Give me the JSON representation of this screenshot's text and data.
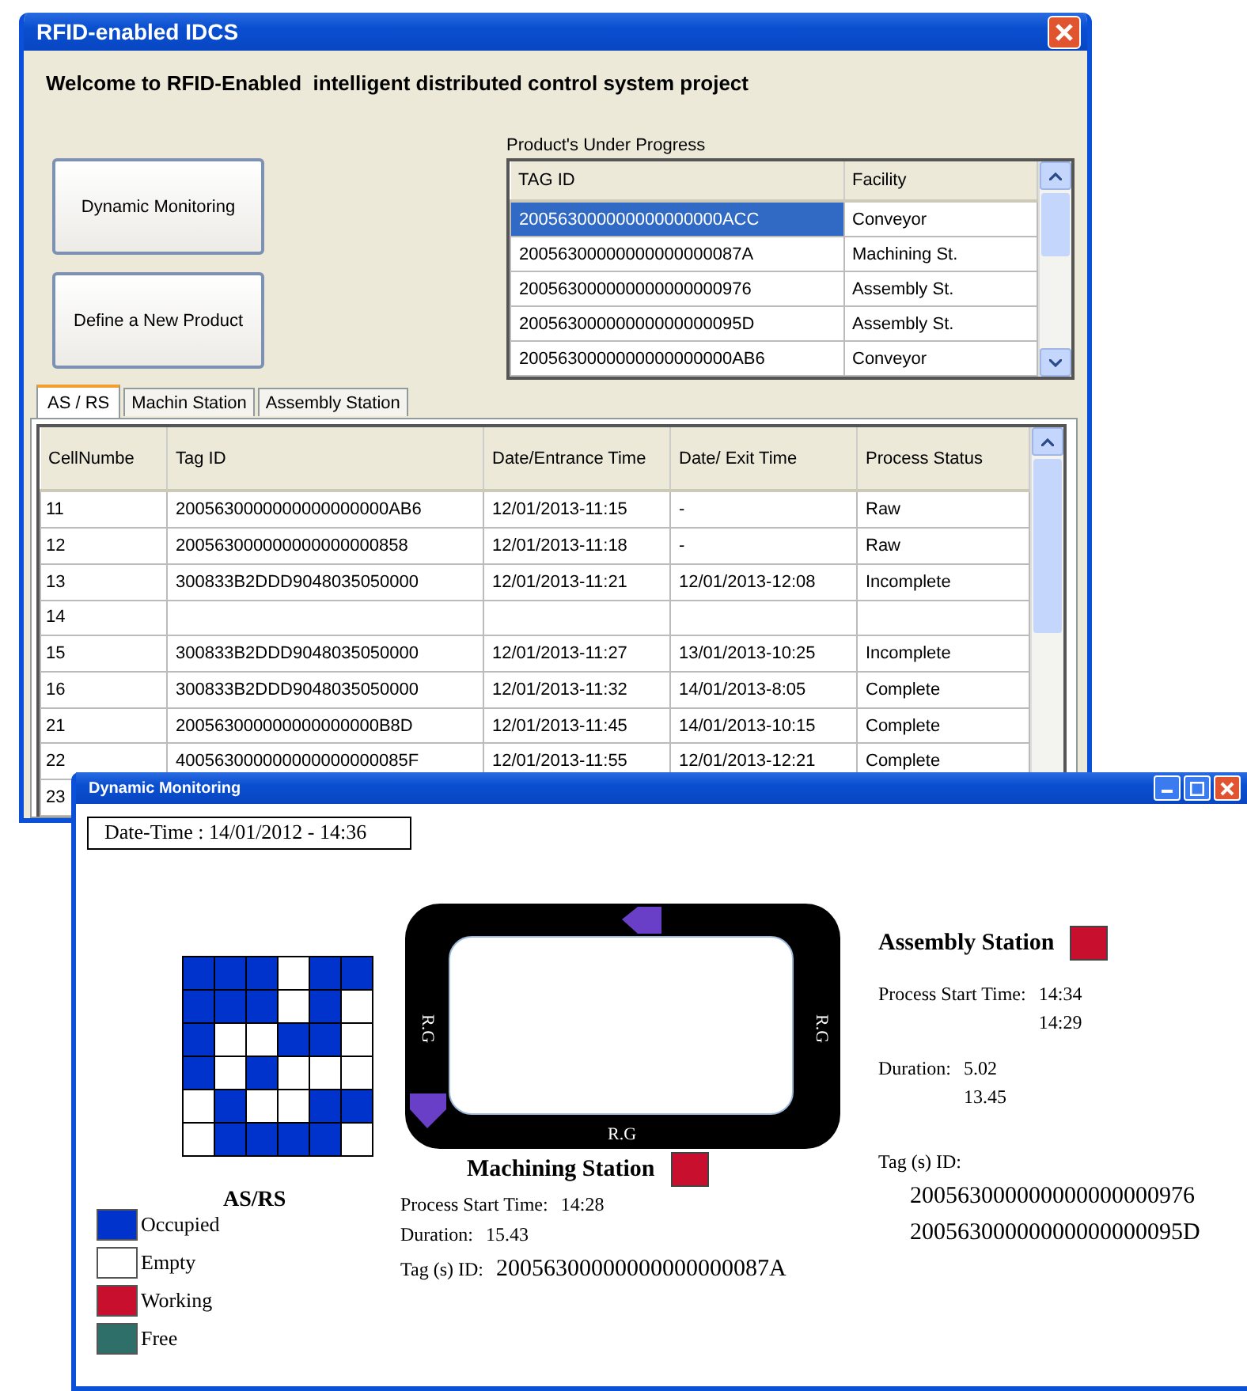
{
  "main_window": {
    "title": "RFID-enabled IDCS",
    "welcome": "Welcome to RFID-Enabled  intelligent distributed control system project",
    "buttons": [
      "Dynamic Monitoring",
      "Define a New Product"
    ],
    "products": {
      "label": "Product's Under Progress",
      "columns": [
        "TAG ID",
        "Facility"
      ],
      "rows": [
        {
          "tag_id": "200563000000000000000ACC",
          "facility": "Conveyor",
          "selected": true
        },
        {
          "tag_id": "20056300000000000000087A",
          "facility": "Machining St.",
          "selected": false
        },
        {
          "tag_id": "200563000000000000000976",
          "facility": "Assembly St.",
          "selected": false
        },
        {
          "tag_id": "20056300000000000000095D",
          "facility": "Assembly St.",
          "selected": false
        },
        {
          "tag_id": "2005630000000000000000AB6",
          "facility": "Conveyor",
          "selected": false
        }
      ]
    },
    "tabs": [
      {
        "label": "AS / RS",
        "selected": true
      },
      {
        "label": "Machin Station",
        "selected": false
      },
      {
        "label": "Assembly Station",
        "selected": false
      }
    ],
    "table": {
      "columns": [
        "CellNumbe",
        "Tag ID",
        "Date/Entrance Time",
        "Date/ Exit Time",
        "Process Status"
      ],
      "rows": [
        {
          "cells": [
            "11",
            "2005630000000000000000AB6",
            "12/01/2013-11:15",
            "-",
            "Raw"
          ]
        },
        {
          "cells": [
            "12",
            "200563000000000000000858",
            "12/01/2013-11:18",
            "-",
            "Raw"
          ]
        },
        {
          "cells": [
            "13",
            "300833B2DDD9048035050000",
            "12/01/2013-11:21",
            "12/01/2013-12:08",
            "Incomplete"
          ]
        },
        {
          "cells": [
            "14"
          ]
        },
        {
          "cells": [
            "15",
            "300833B2DDD9048035050000",
            "12/01/2013-11:27",
            "13/01/2013-10:25",
            "Incomplete"
          ]
        },
        {
          "cells": [
            "16",
            "300833B2DDD9048035050000",
            "12/01/2013-11:32",
            "14/01/2013-8:05",
            "Complete"
          ]
        },
        {
          "cells": [
            "21",
            "200563000000000000000B8D",
            "12/01/2013-11:45",
            "14/01/2013-10:15",
            "Complete"
          ]
        },
        {
          "cells": [
            "22",
            "400563000000000000000085F",
            "12/01/2013-11:55",
            "12/01/2013-12:21",
            "Complete"
          ]
        },
        {
          "cells": [
            "23"
          ]
        }
      ]
    }
  },
  "monitoring_window": {
    "title": "Dynamic Monitoring",
    "date_time": "Date-Time : 14/01/2012 - 14:36",
    "asrs": {
      "label": "AS/RS",
      "grid": [
        [
          {
            "occupied": true
          },
          {
            "occupied": true
          },
          {
            "occupied": true
          },
          {
            "occupied": false
          },
          {
            "occupied": true
          },
          {
            "occupied": true
          }
        ],
        [
          {
            "occupied": true
          },
          {
            "occupied": true
          },
          {
            "occupied": true
          },
          {
            "occupied": false
          },
          {
            "occupied": true
          },
          {
            "occupied": false
          }
        ],
        [
          {
            "occupied": true
          },
          {
            "occupied": false
          },
          {
            "occupied": false
          },
          {
            "occupied": true
          },
          {
            "occupied": true
          },
          {
            "occupied": false
          }
        ],
        [
          {
            "occupied": true
          },
          {
            "occupied": false
          },
          {
            "occupied": true
          },
          {
            "occupied": false
          },
          {
            "occupied": false
          },
          {
            "occupied": false
          }
        ],
        [
          {
            "occupied": false
          },
          {
            "occupied": true
          },
          {
            "occupied": false
          },
          {
            "occupied": false
          },
          {
            "occupied": true
          },
          {
            "occupied": true
          }
        ],
        [
          {
            "occupied": false
          },
          {
            "occupied": true
          },
          {
            "occupied": true
          },
          {
            "occupied": true
          },
          {
            "occupied": true
          },
          {
            "occupied": false
          }
        ]
      ]
    },
    "conveyor": {
      "labels": [
        "R.G",
        "R.G",
        "R.G"
      ]
    },
    "machining": {
      "name": "Machining Station",
      "color": "#c8102e",
      "start_label": "Process Start Time:",
      "start_times": [
        "14:28"
      ],
      "duration_label": "Duration:",
      "durations": [
        "15.43"
      ],
      "tag_label": "Tag (s) ID:",
      "tags": [
        "20056300000000000000087A"
      ]
    },
    "assembly": {
      "name": "Assembly Station",
      "color": "#c8102e",
      "start_label": "Process Start Time:",
      "start_times": [
        "14:34",
        "14:29"
      ],
      "duration_label": "Duration:",
      "durations": [
        "5.02",
        "13.45"
      ],
      "tag_label": "Tag (s) ID:",
      "tags": [
        "200563000000000000000976",
        "20056300000000000000095D"
      ]
    },
    "legend": [
      {
        "label": "Occupied",
        "color": "#0033cc"
      },
      {
        "label": "Empty",
        "color": "#ffffff"
      },
      {
        "label": "Working",
        "color": "#c8102e"
      },
      {
        "label": "Free",
        "color": "#2f6f6a"
      }
    ]
  }
}
